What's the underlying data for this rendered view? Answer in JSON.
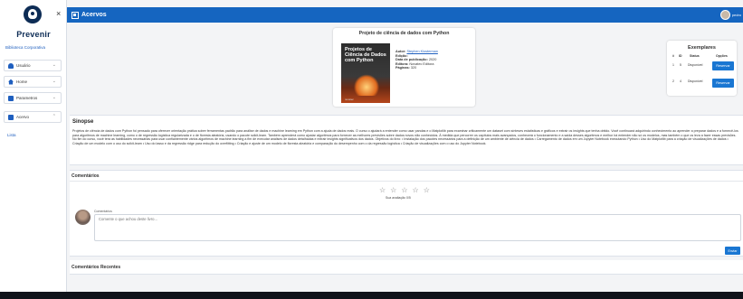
{
  "sidebar": {
    "brand": "Prevenir",
    "org": "Biblioteca Corporativa",
    "items": [
      {
        "label": "Usuário",
        "icon": "user-icon"
      },
      {
        "label": "Home",
        "icon": "home-icon"
      },
      {
        "label": "Parametros",
        "icon": "params-icon"
      },
      {
        "label": "Acervo",
        "icon": "book-icon"
      }
    ],
    "sub_item": "Lista"
  },
  "topbar": {
    "title": "Acervos",
    "user": "pedro",
    "color": "#1565c0"
  },
  "book": {
    "title": "Projeto de ciência de dados com Python",
    "cover_title": "Projetos de Ciência de Dados com Python",
    "cover_publisher": "novatec",
    "author_label": "Autor:",
    "author": "Stephen Klosterman",
    "edition_label": "Edição:",
    "edition": "",
    "pub_date_label": "Data de publicação:",
    "pub_date": "2020",
    "publisher_label": "Editora:",
    "publisher": "Novatec Editora",
    "pages_label": "Páginas:",
    "pages": "320"
  },
  "copies": {
    "title": "Exemplares",
    "headers": [
      "#",
      "ID",
      "Status",
      "Opções"
    ],
    "rows": [
      {
        "num": "1",
        "id": "5",
        "status": "Disponível",
        "button": "Reservar"
      },
      {
        "num": "2",
        "id": "4",
        "status": "Disponível",
        "button": "Reservar"
      }
    ]
  },
  "sinopse": {
    "title": "Sinopse",
    "text": "Projetos de ciência de dados com Python foi pensado para oferecer orientação prática sobre ferramentas padrão para análise de dados e machine learning em Python com a ajuda de dados reais. O curso o ajudará a entender como usar pandas e o Matplotlib para examinar criticamente um dataset com sínteses estatísticas e gráficos e extrair os insights que tenha obtido. Você continuará adquirindo conhecimento ao aprender a preparar dados e a fornecê-los para algoritmos de machine learning, como o de regressão logística regularizada e o de floresta aleatória, usando o pacote scikit-learn. Também aprenderá como ajustar algoritmos para fornecer as melhores previsões sobre dados novos não conhecidos. À medida que percorrer os capítulos mais avançados, conhecerá o funcionamento e a saída desses algoritmos e melhor irá entender não só os modelos, mas também o que os leva a fazer essas previsões. No fim do curso, você terá as habilidades necessárias para usar confiantemente vários algoritmos de machine learning a fim de executar análises de dados detalhadas e extrair insights significativos dos dados. Objetivos do livro: • Instalação dos pacotes necessários para a definição de um ambiente de ciência de dados • Carregamento de dados em um Jupyter Notebook executando Python • Uso do Matplotlib para a criação de visualizações de dados • Criação de um modelo com o uso do scikit-learn • Uso do lasso e da regressão ridge para redução do overfitting • Criação e ajuste de um modelo de floresta aleatória e comparação do desempenho com o da regressão logística • Criação de visualizações com o uso do Jupyter Notebook."
  },
  "comments": {
    "title": "Comentários",
    "stars": [
      "☆",
      "☆",
      "☆",
      "☆",
      "☆"
    ],
    "rating_text": "Sua avaliação 0/5",
    "field_label": "Comentários",
    "placeholder": "Comente o que achou deste livro...",
    "send_button": "Enviar"
  },
  "recent": {
    "title": "Comentários Recentes"
  }
}
